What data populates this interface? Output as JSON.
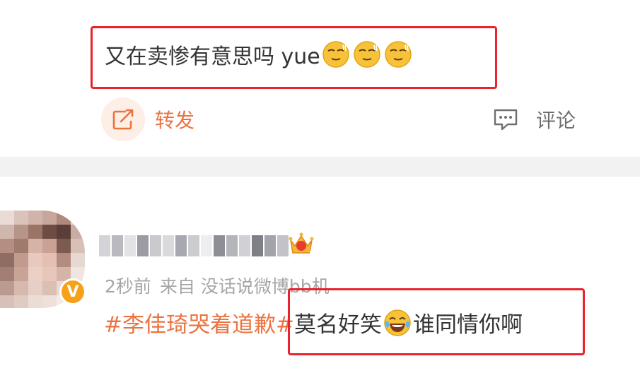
{
  "post1": {
    "text": "又在卖惨有意思吗 yue",
    "emoji_icons": [
      "sweat-face-icon",
      "sweat-face-icon",
      "sweat-face-icon"
    ]
  },
  "actions": {
    "repost_label": "转发",
    "comment_label": "评论"
  },
  "post2": {
    "username": "",
    "time": "2秒前",
    "source": "来自 没话说微博bb机",
    "hashtag": "#李佳琦哭着道歉#",
    "text_before_emoji": "莫名好笑",
    "emoji_icon": "laughing-tears-icon",
    "text_after_emoji": "谁同情你啊",
    "badge_icon": "verified-v-icon",
    "badge_text": "V",
    "crown_icon": "vip-crown-icon"
  },
  "colors": {
    "accent": "#eb7340",
    "highlight_box": "#e8232c",
    "meta_gray": "#a6a6a6",
    "divider": "#f2f2f2"
  }
}
